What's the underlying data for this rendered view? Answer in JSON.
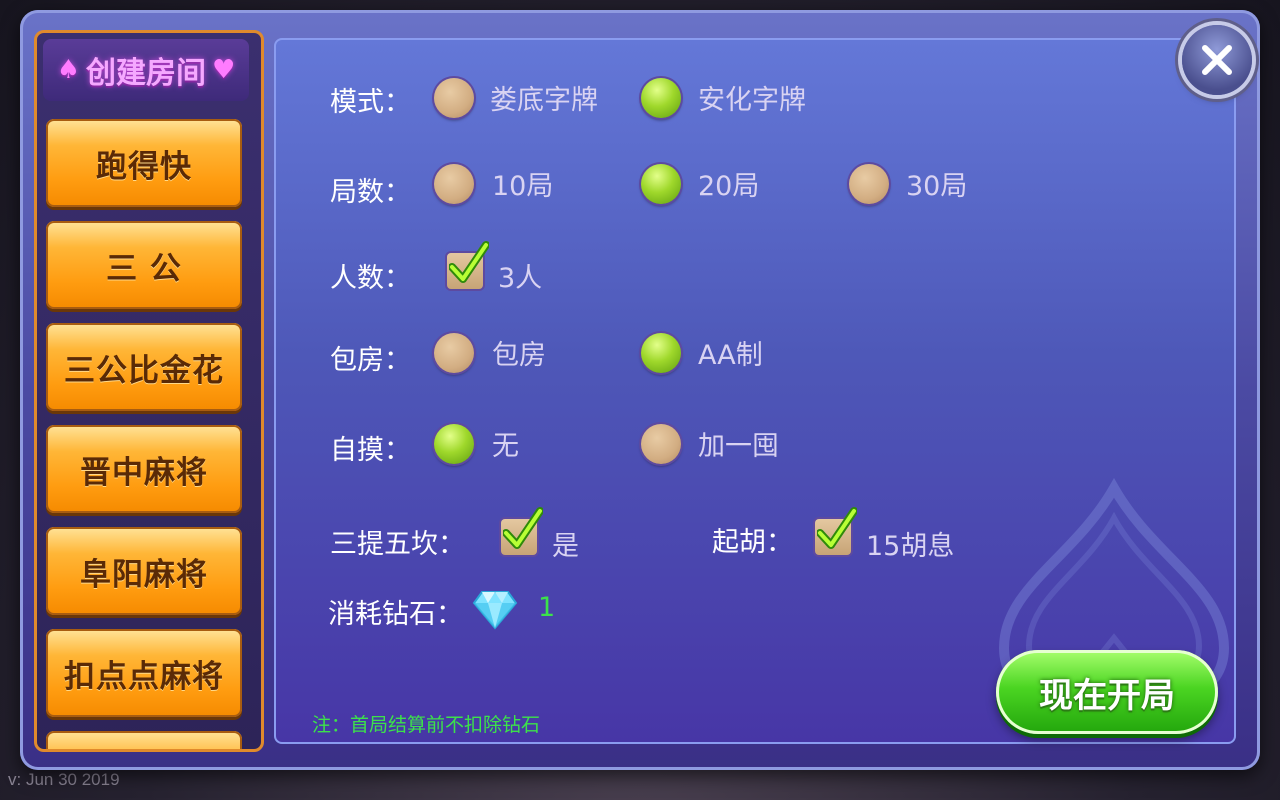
{
  "version": "v: Jun 30 2019",
  "sidebar": {
    "title": "创建房间",
    "suit_left": "♠",
    "suit_right": "♥",
    "items": [
      "跑得快",
      "三 公",
      "三公比金花",
      "晋中麻将",
      "阜阳麻将",
      "扣点点麻将"
    ]
  },
  "settings": {
    "mode": {
      "label": "模式：",
      "options": [
        "娄底字牌",
        "安化字牌"
      ],
      "selected": 1
    },
    "rounds": {
      "label": "局数：",
      "options": [
        "10局",
        "20局",
        "30局"
      ],
      "selected": 1
    },
    "players": {
      "label": "人数：",
      "option": "3人",
      "checked": true
    },
    "room": {
      "label": "包房：",
      "options": [
        "包房",
        "AA制"
      ],
      "selected": 1
    },
    "self_draw": {
      "label": "自摸：",
      "options": [
        "无",
        "加一囤"
      ],
      "selected": 0
    },
    "santi": {
      "label": "三提五坎：",
      "option": "是",
      "checked": true
    },
    "qihu": {
      "label": "起胡：",
      "option": "15胡息",
      "checked": true
    },
    "cost": {
      "label": "消耗钻石：",
      "value": "1"
    },
    "note": "注：首局结算前不扣除钻石"
  },
  "actions": {
    "start": "现在开局"
  },
  "colors": {
    "accent_green": "#3ce24a",
    "orange": "#ff9c10",
    "panel": "#4e58b8"
  },
  "icons": {
    "close": "close-icon",
    "diamond": "diamond-icon",
    "check": "check-icon"
  }
}
